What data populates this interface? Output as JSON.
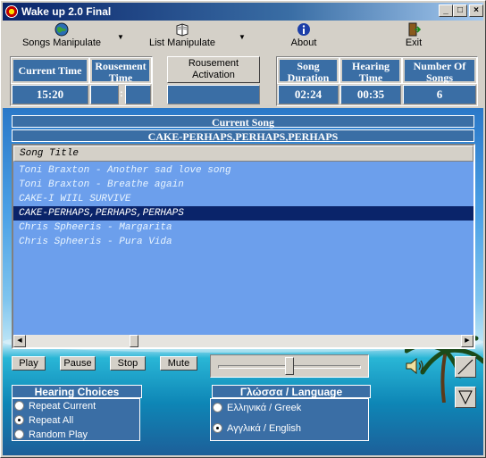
{
  "window": {
    "title": "Wake up 2.0 Final",
    "minimize": "_",
    "maximize": "□",
    "close": "×"
  },
  "menu": {
    "songs_manipulate": "Songs Manipulate",
    "list_manipulate": "List Manipulate",
    "about": "About",
    "exit": "Exit",
    "dropdown_arrow": "▼"
  },
  "info": {
    "current_time_label": "Current Time",
    "current_time_value": "15:20",
    "rousement_time_label": "Rousement Time",
    "rousement_time_sep": ":",
    "rousement_activation_label": "Rousement Activation",
    "song_duration_label": "Song Duration",
    "song_duration_value": "02:24",
    "hearing_time_label": "Hearing Time",
    "hearing_time_value": "00:35",
    "number_of_songs_label": "Number Of Songs",
    "number_of_songs_value": "6"
  },
  "current_song": {
    "label": "Current Song",
    "value": "CAKE-PERHAPS,PERHAPS,PERHAPS"
  },
  "playlist": {
    "column_header": "Song Title",
    "rows": [
      "Toni Braxton - Another sad love song",
      "Toni Braxton - Breathe again",
      "CAKE-I WIIL SURVIVE",
      "CAKE-PERHAPS,PERHAPS,PERHAPS",
      "Chris Spheeris - Margarita",
      "Chris Spheeris - Pura Vida"
    ],
    "selected_index": 3
  },
  "controls": {
    "play": "Play",
    "pause": "Pause",
    "stop": "Stop",
    "mute": "Mute",
    "volume": 0.5
  },
  "hearing_choices": {
    "title": "Hearing Choices",
    "options": [
      "Repeat Current",
      "Repeat All",
      "Random Play"
    ],
    "selected": "Repeat All"
  },
  "language": {
    "title": "Γλώσσα  /  Language",
    "options": [
      "Ελληνικά / Greek",
      "Αγγλικά / English"
    ],
    "selected": "Αγγλικά / English"
  },
  "colors": {
    "panel_blue": "#3a6ea5",
    "list_blue": "#6c9fec",
    "selection": "#0a246a"
  }
}
